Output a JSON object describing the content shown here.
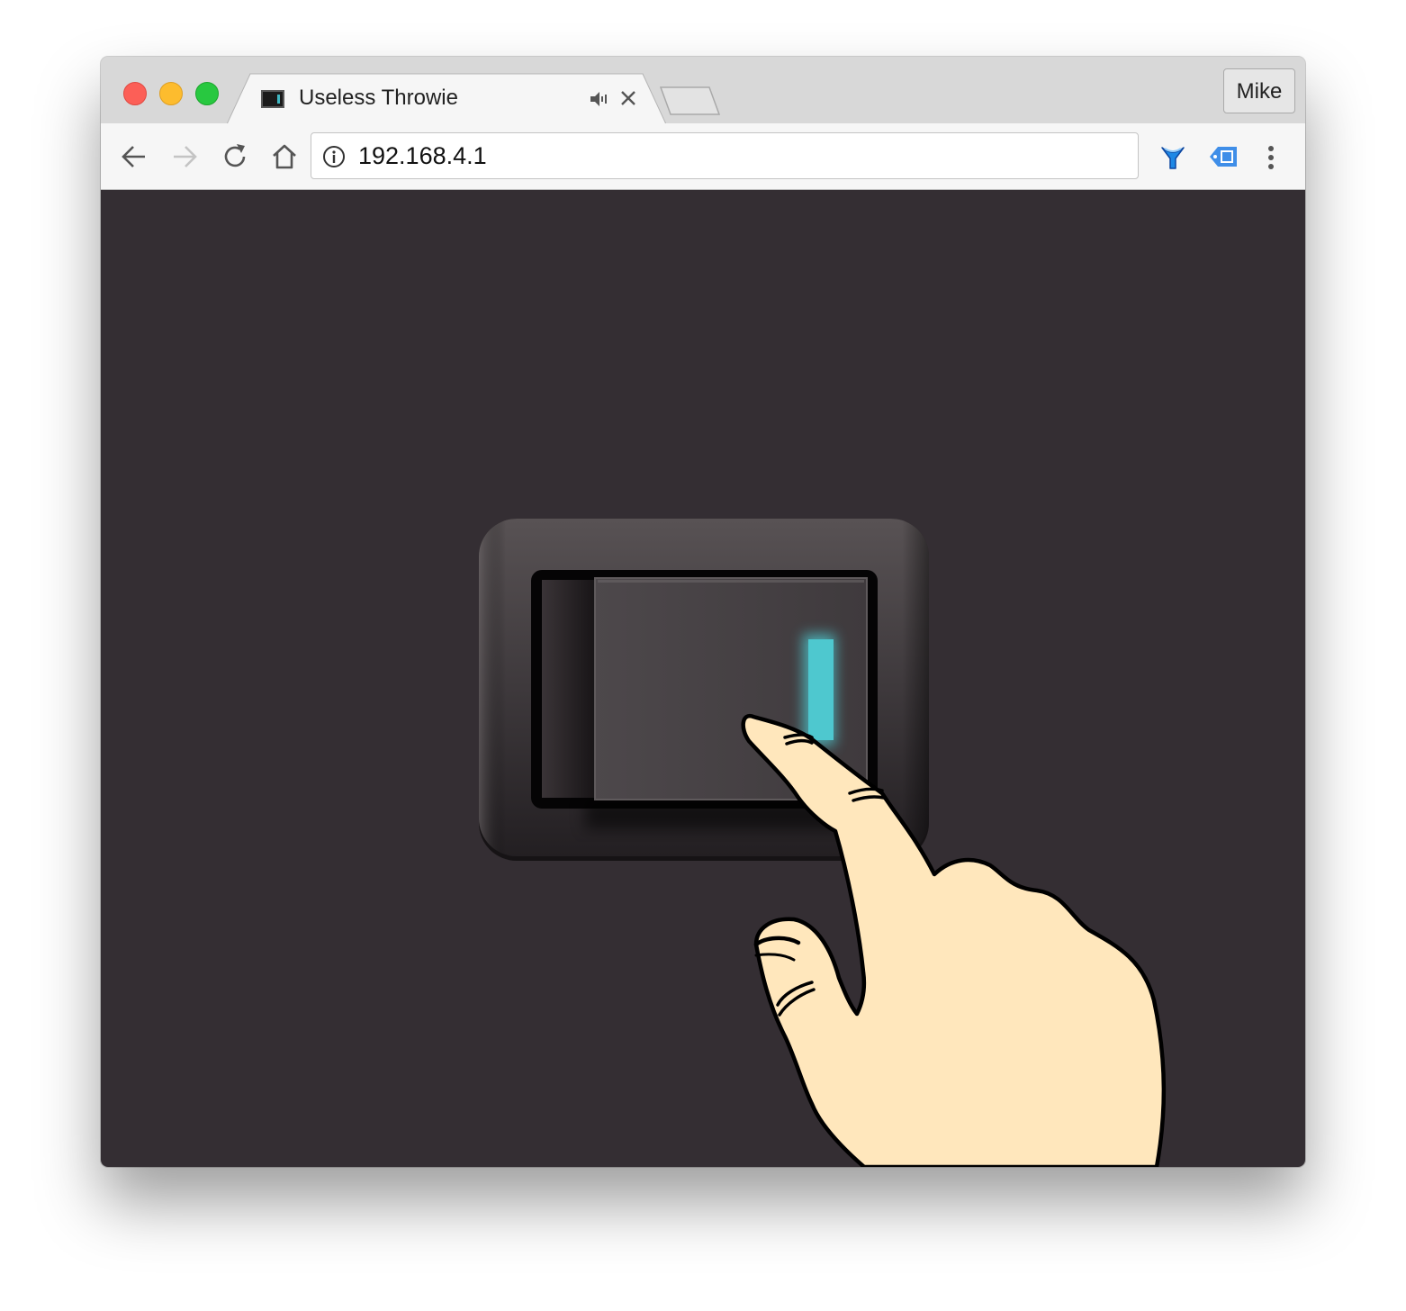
{
  "browser": {
    "tab": {
      "title": "Useless Throwie",
      "audio_icon": "speaker-icon",
      "close_icon": "close-icon"
    },
    "profile_name": "Mike",
    "url": "192.168.4.1",
    "toolbar_icons": [
      "back-arrow-icon",
      "forward-arrow-icon",
      "reload-icon",
      "home-icon",
      "info-icon",
      "extension-y-icon",
      "extension-tag-icon",
      "more-vert-icon"
    ]
  },
  "page": {
    "background": "#342e33",
    "switch": {
      "state": "on",
      "indicator_color": "#4ec8cf"
    },
    "hand_color": "#ffe7bc"
  }
}
